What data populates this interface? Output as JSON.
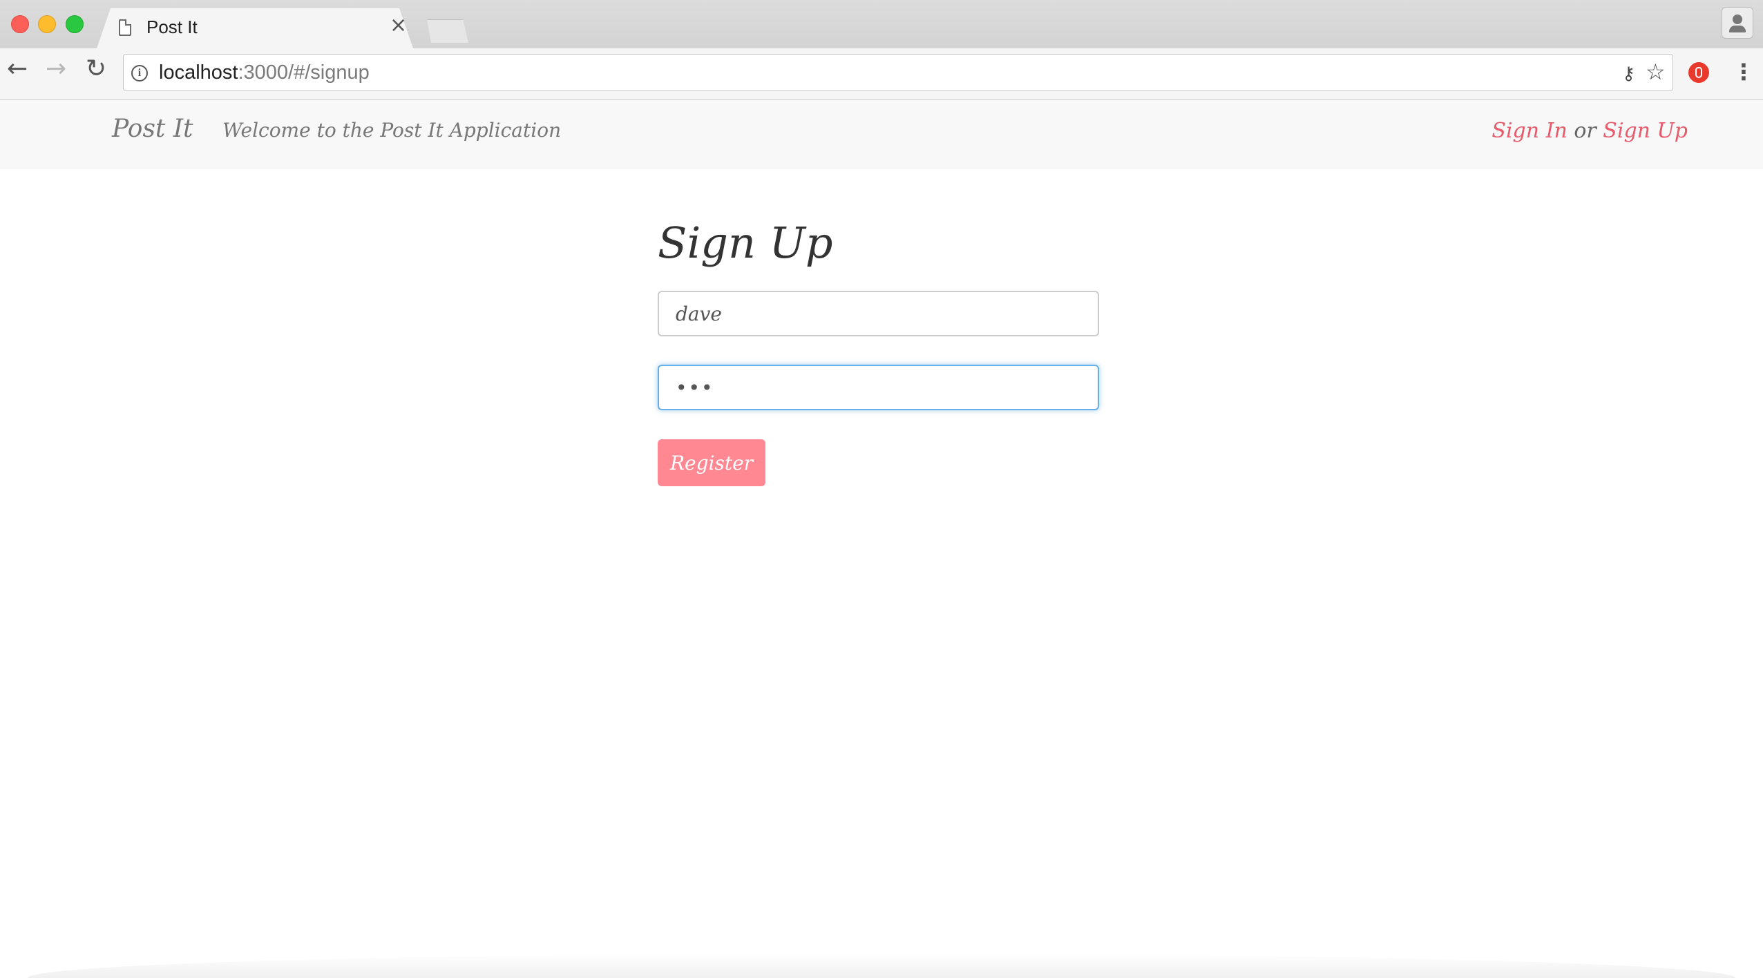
{
  "browser": {
    "tab_title": "Post It",
    "tab_close_glyph": "×",
    "url_host": "localhost",
    "url_path": ":3000/#/signup",
    "info_glyph": "i"
  },
  "navbar": {
    "brand": "Post It",
    "welcome": "Welcome to the Post It Application",
    "sign_in": "Sign In",
    "or": "or",
    "sign_up": "Sign Up"
  },
  "form": {
    "title": "Sign Up",
    "username_value": "dave",
    "password_value": "•••",
    "register_label": "Register"
  },
  "colors": {
    "accent": "#ff8893",
    "link": "#e65a6a",
    "focus": "#66afe9"
  }
}
